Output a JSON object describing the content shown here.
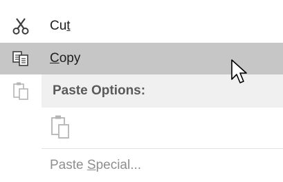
{
  "menu": {
    "cut": {
      "label_pre": "Cu",
      "label_accel": "t",
      "label_post": "",
      "icon": "scissors-icon"
    },
    "copy": {
      "label_pre": "",
      "label_accel": "C",
      "label_post": "opy",
      "icon": "copy-icon"
    },
    "paste_options": {
      "label": "Paste Options:",
      "icon": "paste-icon"
    },
    "paste_keep": {
      "icon": "paste-keep-source-icon"
    },
    "paste_special": {
      "label_pre": "Paste ",
      "label_accel": "S",
      "label_post": "pecial...",
      "icon": ""
    }
  },
  "colors": {
    "highlight": "#c6c6c6",
    "header_band": "#f0f0f0",
    "disabled_text": "#8e8e8e",
    "text": "#1e1e1e"
  },
  "cursor": {
    "icon": "mouse-pointer-icon"
  }
}
